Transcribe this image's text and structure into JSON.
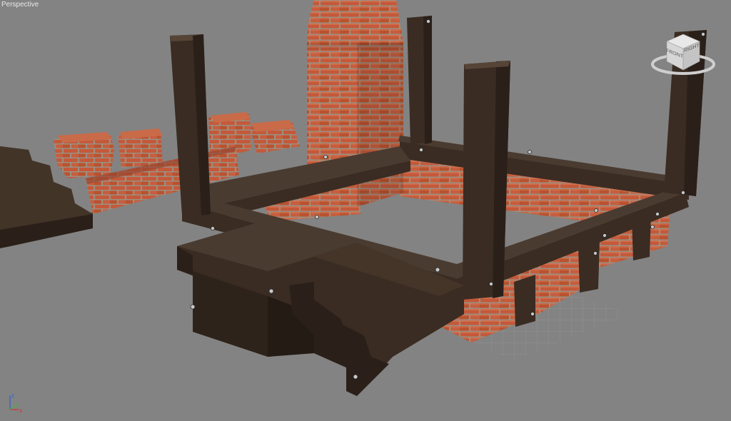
{
  "viewport": {
    "label": "Perspective"
  },
  "viewcube": {
    "front_label": "FRONT",
    "right_label": "RIGHT"
  },
  "axis_tripod": {
    "x_label": "x",
    "y_label": "y",
    "z_label": "z"
  },
  "colors": {
    "background": "#838383",
    "wood_dark": "#3a2c22",
    "wood_side": "#2a2019",
    "wood_top": "#4a3b30",
    "brick": "#c0583a",
    "brick_dark": "#8f3d28",
    "mortar": "#a89c8e"
  }
}
